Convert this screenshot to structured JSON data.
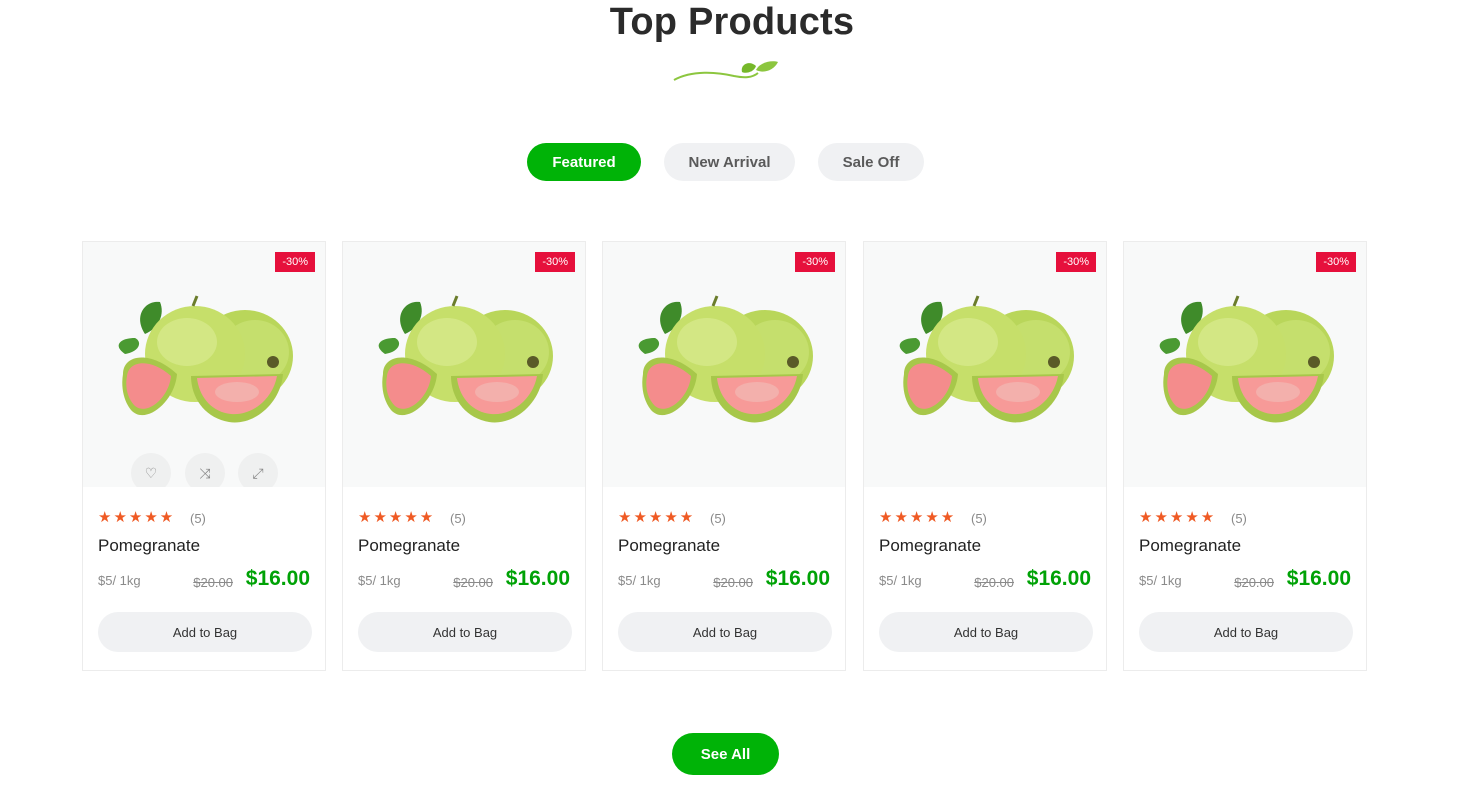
{
  "section": {
    "title": "Top Products",
    "divider_icon": "leaf-vine-icon"
  },
  "tabs": [
    {
      "label": "Featured",
      "active": true
    },
    {
      "label": "New Arrival",
      "active": false
    },
    {
      "label": "Sale Off",
      "active": false
    }
  ],
  "products": [
    {
      "name": "Pomegranate",
      "badge": "-30%",
      "rating": 5,
      "stars": "★★★★★",
      "rating_count": "(5)",
      "unit": "$5/ 1kg",
      "old_price": "$20.00",
      "price": "$16.00",
      "cta": "Add to Bag"
    },
    {
      "name": "Pomegranate",
      "badge": "-30%",
      "rating": 5,
      "stars": "★★★★★",
      "rating_count": "(5)",
      "unit": "$5/ 1kg",
      "old_price": "$20.00",
      "price": "$16.00",
      "cta": "Add to Bag"
    },
    {
      "name": "Pomegranate",
      "badge": "-30%",
      "rating": 5,
      "stars": "★★★★★",
      "rating_count": "(5)",
      "unit": "$5/ 1kg",
      "old_price": "$20.00",
      "price": "$16.00",
      "cta": "Add to Bag"
    },
    {
      "name": "Pomegranate",
      "badge": "-30%",
      "rating": 5,
      "stars": "★★★★★",
      "rating_count": "(5)",
      "unit": "$5/ 1kg",
      "old_price": "$20.00",
      "price": "$16.00",
      "cta": "Add to Bag"
    },
    {
      "name": "Pomegranate",
      "badge": "-30%",
      "rating": 5,
      "stars": "★★★★★",
      "rating_count": "(5)",
      "unit": "$5/ 1kg",
      "old_price": "$20.00",
      "price": "$16.00",
      "cta": "Add to Bag"
    }
  ],
  "hover_actions": [
    "heart-icon",
    "shuffle-icon",
    "expand-icon"
  ],
  "see_all_label": "See All",
  "colors": {
    "accent": "#00b307",
    "price": "#00a206",
    "badge": "#e6103c",
    "star": "#ef5a24"
  }
}
